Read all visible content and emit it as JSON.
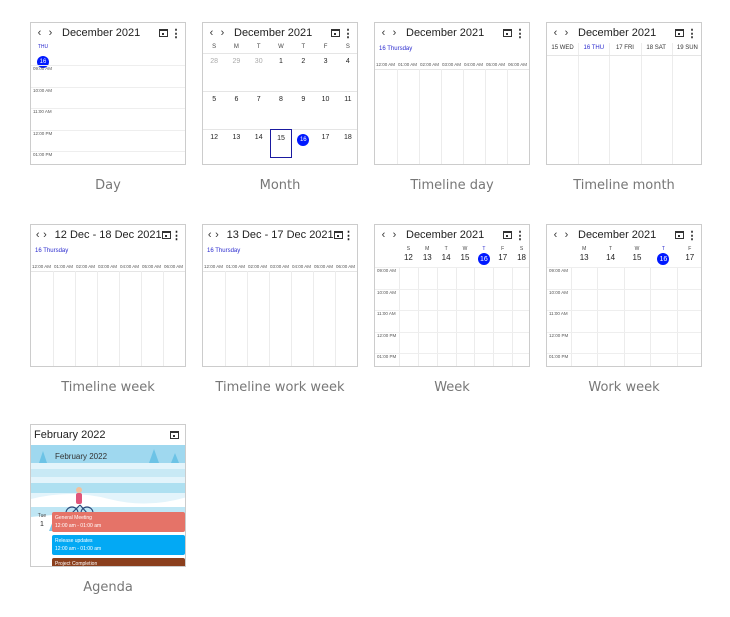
{
  "labels": {
    "day": "Day",
    "month": "Month",
    "timeline_day": "Timeline day",
    "timeline_month": "Timeline month",
    "timeline_week": "Timeline week",
    "timeline_work_week": "Timeline work week",
    "week": "Week",
    "work_week": "Work week",
    "agenda": "Agenda"
  },
  "nav": {
    "prev": "‹",
    "next": "›",
    "more": "⋮"
  },
  "headers": {
    "dec": "December 2021",
    "tweek": "12 Dec - 18 Dec 2021",
    "twork": "13 Dec - 17 Dec 2021",
    "feb": "February 2022"
  },
  "day": {
    "dow": "THU",
    "date": "16",
    "times": [
      "09:00 AM",
      "10:00 AM",
      "11:00 AM",
      "12:00 PM",
      "01:00 PM"
    ]
  },
  "month": {
    "dows": [
      "S",
      "M",
      "T",
      "W",
      "T",
      "F",
      "S"
    ],
    "rows": [
      [
        "28",
        "29",
        "30",
        "1",
        "2",
        "3",
        "4"
      ],
      [
        "5",
        "6",
        "7",
        "8",
        "9",
        "10",
        "11"
      ],
      [
        "12",
        "13",
        "14",
        "15",
        "16",
        "17",
        "18"
      ]
    ],
    "selected": "15",
    "today": "16"
  },
  "timeline_day": {
    "label": "16 Thursday",
    "hours": [
      "12:00 AM",
      "01:00 AM",
      "02:00 AM",
      "03:00 AM",
      "04:00 AM",
      "05:00 AM",
      "06:00 AM",
      "07:00 AM"
    ]
  },
  "timeline_month": {
    "days": [
      "15 WED",
      "16 THU",
      "17 FRI",
      "18 SAT",
      "19 SUN"
    ]
  },
  "timeline_week": {
    "label": "16 Thursday",
    "hours": [
      "12:00 AM",
      "01:00 AM",
      "02:00 AM",
      "03:00 AM",
      "04:00 AM",
      "05:00 AM",
      "06:00 AM",
      "07:00 AM"
    ]
  },
  "timeline_work_week": {
    "label": "16 Thursday",
    "hours": [
      "12:00 AM",
      "01:00 AM",
      "02:00 AM",
      "03:00 AM",
      "04:00 AM",
      "05:00 AM",
      "06:00 AM",
      "07:00 AM"
    ]
  },
  "week": {
    "dows": [
      "S",
      "M",
      "T",
      "W",
      "T",
      "F",
      "S"
    ],
    "dates": [
      "12",
      "13",
      "14",
      "15",
      "16",
      "17",
      "18"
    ],
    "today": "16",
    "times": [
      "09:00 AM",
      "10:00 AM",
      "11:00 AM",
      "12:00 PM",
      "01:00 PM"
    ]
  },
  "work_week": {
    "dows": [
      "M",
      "T",
      "W",
      "T",
      "F"
    ],
    "dates": [
      "13",
      "14",
      "15",
      "16",
      "17"
    ],
    "today": "16",
    "times": [
      "09:00 AM",
      "10:00 AM",
      "11:00 AM",
      "12:00 PM",
      "01:00 PM"
    ]
  },
  "agenda": {
    "banner": "February 2022",
    "dow": "Tue",
    "date": "1",
    "events": [
      {
        "title": "General Meeting",
        "time": "12:00 am - 01:00 am",
        "color": "#e57368"
      },
      {
        "title": "Release updates",
        "time": "12:00 am - 01:00 am",
        "color": "#03a9f4"
      },
      {
        "title": "Project Completion",
        "time": "",
        "color": "#8b3f1d"
      }
    ]
  },
  "colors": {
    "today": "#0019ff",
    "accent": "#2b2bcf",
    "border": "#cccccc"
  }
}
